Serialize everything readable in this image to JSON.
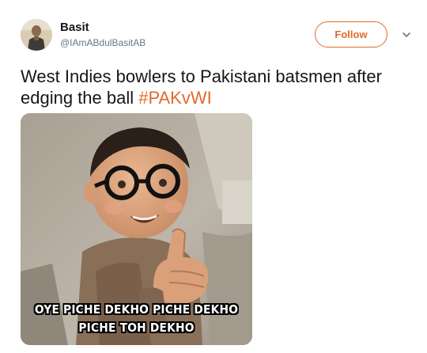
{
  "user": {
    "name": "Basit",
    "handle": "@IAmABdulBasitAB"
  },
  "actions": {
    "follow_label": "Follow",
    "more_icon": "chevron-down-icon"
  },
  "tweet": {
    "text": "West Indies bowlers to Pakistani batsmen after edging the ball ",
    "hashtag": "#PAKvWI"
  },
  "media": {
    "caption_line1": "OYE PICHE DEKHO PICHE DEKHO",
    "caption_line2": "PICHE TOH DEKHO"
  },
  "colors": {
    "accent": "#e16a2a",
    "handle_gray": "#657786",
    "text": "#14171a"
  }
}
